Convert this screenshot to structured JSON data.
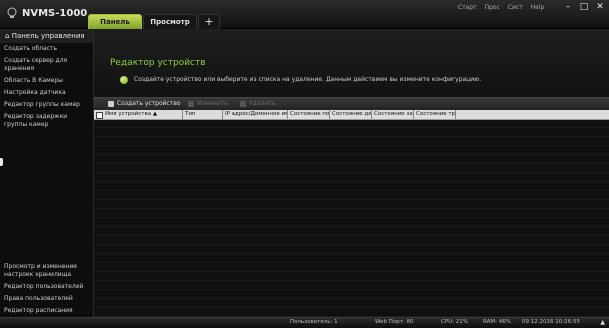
{
  "app": {
    "title": "NVMS-1000"
  },
  "tabs": [
    {
      "label": "Панель управ"
    },
    {
      "label": "Просмотр"
    },
    {
      "label": "+"
    }
  ],
  "top_menu": [
    "Старт",
    "Прос",
    "Сист",
    "Help"
  ],
  "window_controls": {
    "minimize": "–",
    "maximize": "□",
    "close": "✕"
  },
  "sidebar": {
    "header": "Панель управления",
    "header_icon": "home-icon",
    "items": [
      "Создать область",
      "Создать сервер для хранения",
      "Область В Камеры",
      "Настройка датчика",
      "Редактор группы камер",
      "Редактор задержки группы камер"
    ],
    "bottom_items": [
      "Просмотр и изменение настроек хранилища",
      "Редактор пользователей",
      "Права пользователей",
      "Редактор расписания"
    ]
  },
  "main": {
    "heading": "Редактор устройств",
    "info_text": "Создайте устройство или выберите из списка на удаление. Данным действием вы измените конфигурацию.",
    "toolbar": {
      "add": "Создать устройство",
      "edit": "Изменить",
      "delete": "Удалить"
    },
    "columns": [
      "Имя устройства ▲",
      "Тип",
      "IP адрес/Доменное имя",
      "Состояние под",
      "Состояние дис",
      "Состояние зап",
      "Состояние тре"
    ],
    "rows": []
  },
  "status": {
    "users": "Пользователь: 1",
    "web_port": "Web Порт: 80",
    "cpu": "CPU: 21%",
    "ram": "RAM: 46%",
    "datetime": "09.12.2016 10:26:55"
  },
  "colors": {
    "accent_green": "#8fd13a",
    "tab_active": "#9cc23a",
    "background": "#111111",
    "grid_header": "#dcdcdc"
  }
}
